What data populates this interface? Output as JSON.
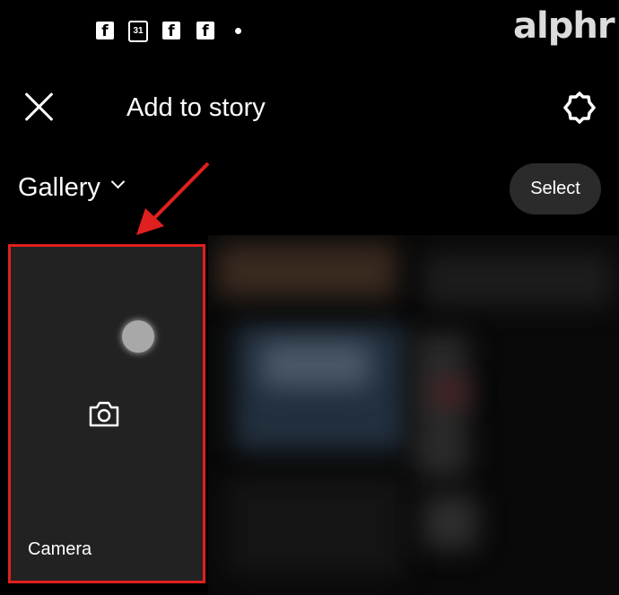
{
  "status_bar": {
    "icons": [
      "facebook-icon",
      "calendar-icon",
      "facebook-icon",
      "facebook-icon",
      "notification-dot-icon"
    ],
    "calendar_day": "31"
  },
  "watermark": {
    "logo": "alphr"
  },
  "header": {
    "title": "Add to story",
    "close_icon": "close-icon",
    "settings_icon": "gear-icon"
  },
  "gallery": {
    "label": "Gallery",
    "select_label": "Select"
  },
  "camera_tile": {
    "label": "Camera",
    "icon": "camera-icon"
  },
  "colors": {
    "highlight": "#e0201e",
    "tile_bg": "#222222",
    "select_bg": "#2b2b2b"
  }
}
